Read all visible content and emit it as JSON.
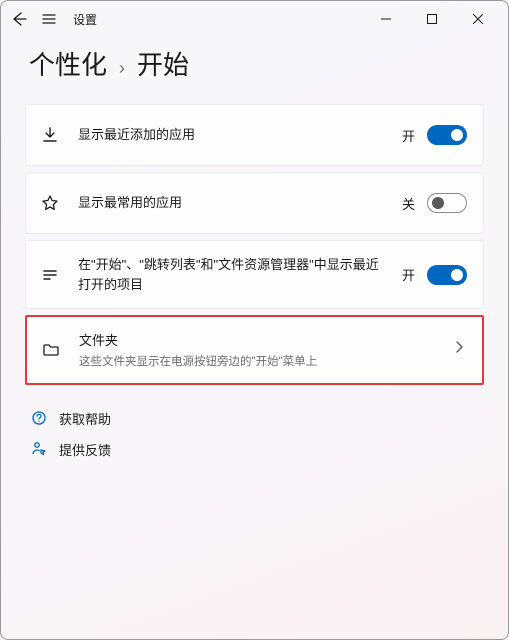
{
  "header": {
    "app_title": "设置"
  },
  "breadcrumb": {
    "parent": "个性化",
    "current": "开始"
  },
  "toggle_labels": {
    "on": "开",
    "off": "关"
  },
  "settings": [
    {
      "id": "recently-added",
      "title": "显示最近添加的应用",
      "state": "on"
    },
    {
      "id": "most-used",
      "title": "显示最常用的应用",
      "state": "off"
    },
    {
      "id": "recent-items",
      "title": "在\"开始\"、\"跳转列表\"和\"文件资源管理器\"中显示最近打开的项目",
      "state": "on"
    }
  ],
  "folders": {
    "title": "文件夹",
    "subtitle": "这些文件夹显示在电源按钮旁边的\"开始\"菜单上"
  },
  "help": {
    "get_help": "获取帮助",
    "give_feedback": "提供反馈"
  }
}
